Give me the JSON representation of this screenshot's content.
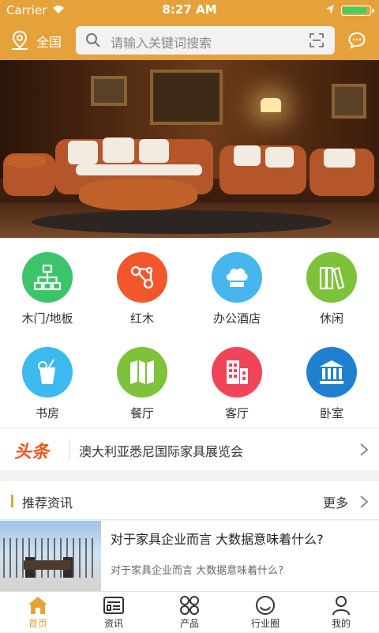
{
  "status_bar": {
    "carrier": "Carrier",
    "time": "8:27 AM"
  },
  "header": {
    "location": "全国",
    "search_placeholder": "请输入关键词搜索"
  },
  "categories": [
    {
      "label": "木门/地板",
      "color": "#3cc46a",
      "icon": "org-chart-icon"
    },
    {
      "label": "红木",
      "color": "#f2562b",
      "icon": "chain-icon"
    },
    {
      "label": "办公酒店",
      "color": "#46b6ec",
      "icon": "chef-hat-icon"
    },
    {
      "label": "休闲",
      "color": "#7dc23a",
      "icon": "books-icon"
    },
    {
      "label": "书房",
      "color": "#3cb9ef",
      "icon": "drink-icon"
    },
    {
      "label": "餐厅",
      "color": "#7dc23a",
      "icon": "map-fold-icon"
    },
    {
      "label": "客厅",
      "color": "#f04459",
      "icon": "buildings-icon"
    },
    {
      "label": "卧室",
      "color": "#1f80d0",
      "icon": "bank-icon"
    }
  ],
  "headline": {
    "tag": "头条",
    "text": "澳大利亚悉尼国际家具展览会"
  },
  "section": {
    "title": "推荐资讯",
    "more": "更多"
  },
  "news": [
    {
      "title": "对于家具企业而言 大数据意味着什么?",
      "summary": "对于家具企业而言 大数据意味着什么?"
    }
  ],
  "tabs": [
    {
      "label": "首页",
      "icon": "home-icon",
      "active": true
    },
    {
      "label": "资讯",
      "icon": "news-icon",
      "active": false
    },
    {
      "label": "产品",
      "icon": "grid-icon",
      "active": false
    },
    {
      "label": "行业圈",
      "icon": "smile-icon",
      "active": false
    },
    {
      "label": "我的",
      "icon": "user-icon",
      "active": false
    }
  ],
  "colors": {
    "brand": "#e6a23a",
    "headline_tag": "#e9571d"
  }
}
